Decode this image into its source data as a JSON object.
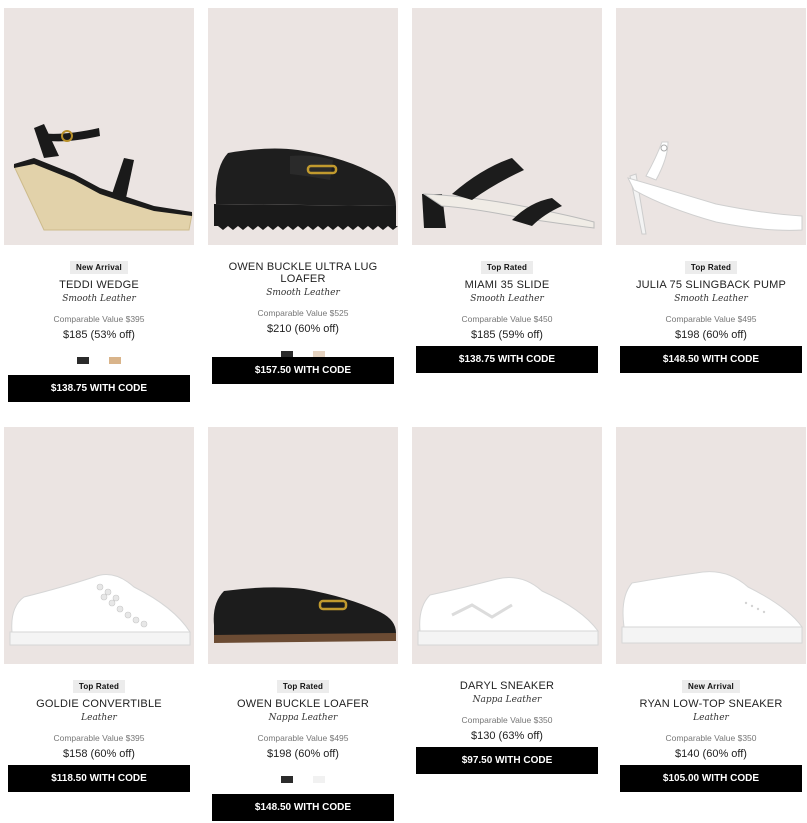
{
  "products": [
    {
      "badge": "New Arrival",
      "name": "TEDDI WEDGE",
      "material": "Smooth Leather",
      "comparable": "Comparable Value $395",
      "price": "$185  (53% off)",
      "swatches": [
        "#2b2b2b",
        "#d9b48a"
      ],
      "code": "$138.75 WITH CODE"
    },
    {
      "badge": "",
      "name": "OWEN BUCKLE ULTRA LUG LOAFER",
      "material": "Smooth Leather",
      "comparable": "Comparable Value $525",
      "price": "$210  (60% off)",
      "swatches": [
        "#2b2b2b",
        "#e5d3c0"
      ],
      "code": "$157.50 WITH CODE"
    },
    {
      "badge": "Top Rated",
      "name": "MIAMI 35 SLIDE",
      "material": "Smooth Leather",
      "comparable": "Comparable Value $450",
      "price": "$185  (59% off)",
      "swatches": [],
      "code": "$138.75 WITH CODE"
    },
    {
      "badge": "Top Rated",
      "name": "JULIA 75 SLINGBACK PUMP",
      "material": "Smooth Leather",
      "comparable": "Comparable Value $495",
      "price": "$198  (60% off)",
      "swatches": [],
      "code": "$148.50 WITH CODE"
    },
    {
      "badge": "Top Rated",
      "name": "GOLDIE CONVERTIBLE",
      "material": "Leather",
      "comparable": "Comparable Value $395",
      "price": "$158  (60% off)",
      "swatches": [],
      "code": "$118.50 WITH CODE"
    },
    {
      "badge": "Top Rated",
      "name": "OWEN BUCKLE LOAFER",
      "material": "Nappa Leather",
      "comparable": "Comparable Value $495",
      "price": "$198  (60% off)",
      "swatches": [
        "#2b2b2b",
        "#f1f1f1"
      ],
      "code": "$148.50 WITH CODE"
    },
    {
      "badge": "",
      "name": "DARYL SNEAKER",
      "material": "Nappa Leather",
      "comparable": "Comparable Value $350",
      "price": "$130  (63% off)",
      "swatches": [],
      "code": "$97.50 WITH CODE"
    },
    {
      "badge": "New Arrival",
      "name": "RYAN LOW-TOP SNEAKER",
      "material": "Leather",
      "comparable": "Comparable Value $350",
      "price": "$140  (60% off)",
      "swatches": [],
      "code": "$105.00 WITH CODE"
    }
  ]
}
